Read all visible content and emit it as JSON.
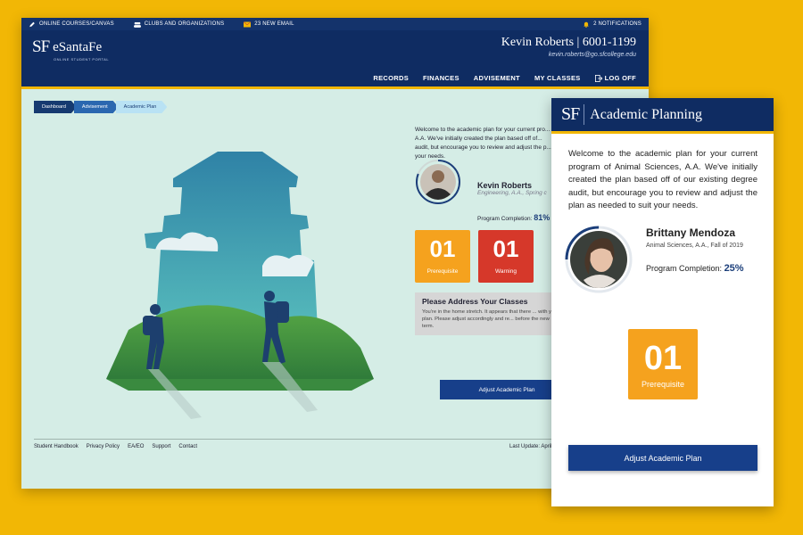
{
  "topbar": {
    "canvas": "ONLINE COURSES/CANVAS",
    "clubs": "CLUBS AND ORGANIZATIONS",
    "email": "23 NEW EMAIL",
    "notifications": "2 NOTIFICATIONS"
  },
  "brand": {
    "mark": "SF",
    "name": "eSantaFe",
    "tagline": "ONLINE STUDENT PORTAL"
  },
  "user": {
    "name_id": "Kevin Roberts | 6001-1199",
    "email": "kevin.roberts@go.sfcollege.edu"
  },
  "nav": [
    "RECORDS",
    "FINANCES",
    "ADVISEMENT",
    "MY CLASSES",
    "LOG OFF"
  ],
  "breadcrumbs": [
    "Dashboard",
    "Advisement",
    "Academic Plan"
  ],
  "desktop": {
    "intro": "Welcome to the academic plan for your current pro... A.A. We've initially created the plan based off of... audit, but encourage you to review and adjust the p... your needs.",
    "student_name": "Kevin Roberts",
    "program": "Engineering, A.A., Spring c",
    "completion_label": "Program Completion:",
    "completion_value": "81%",
    "completion_fraction": 0.81,
    "tiles": [
      {
        "count": "01",
        "label": "Prerequisite",
        "color": "#f5a21e"
      },
      {
        "count": "01",
        "label": "Warning",
        "color": "#d6382a"
      }
    ],
    "address_title": "Please Address Your Classes",
    "address_body": "You're in the home stretch. It appears that there ... with your plan. Please adjust accordingly and re... before the new term.",
    "button": "Adjust Academic Plan"
  },
  "footer": {
    "links": [
      "Student Handbook",
      "Privacy Policy",
      "EA/EO",
      "Support",
      "Contact"
    ],
    "last_update": "Last Update: April"
  },
  "mobile": {
    "mark": "SF",
    "title": "Academic Planning",
    "intro": "Welcome to the academic plan for your current program of Animal Sciences, A.A. We've initially created the plan based off of our existing degree audit, but encourage you to review and adjust the plan as needed to suit your needs.",
    "student_name": "Brittany Mendoza",
    "program": "Animal Sciences, A.A., Fall  of 2019",
    "completion_label": "Program Completion:",
    "completion_value": "25%",
    "completion_fraction": 0.25,
    "tile": {
      "count": "01",
      "label": "Prerequisite"
    },
    "button": "Adjust Academic Plan"
  },
  "colors": {
    "navy": "#0f2c62",
    "accent": "#f2b705",
    "button": "#173f8a",
    "mint": "#d5ede6"
  }
}
